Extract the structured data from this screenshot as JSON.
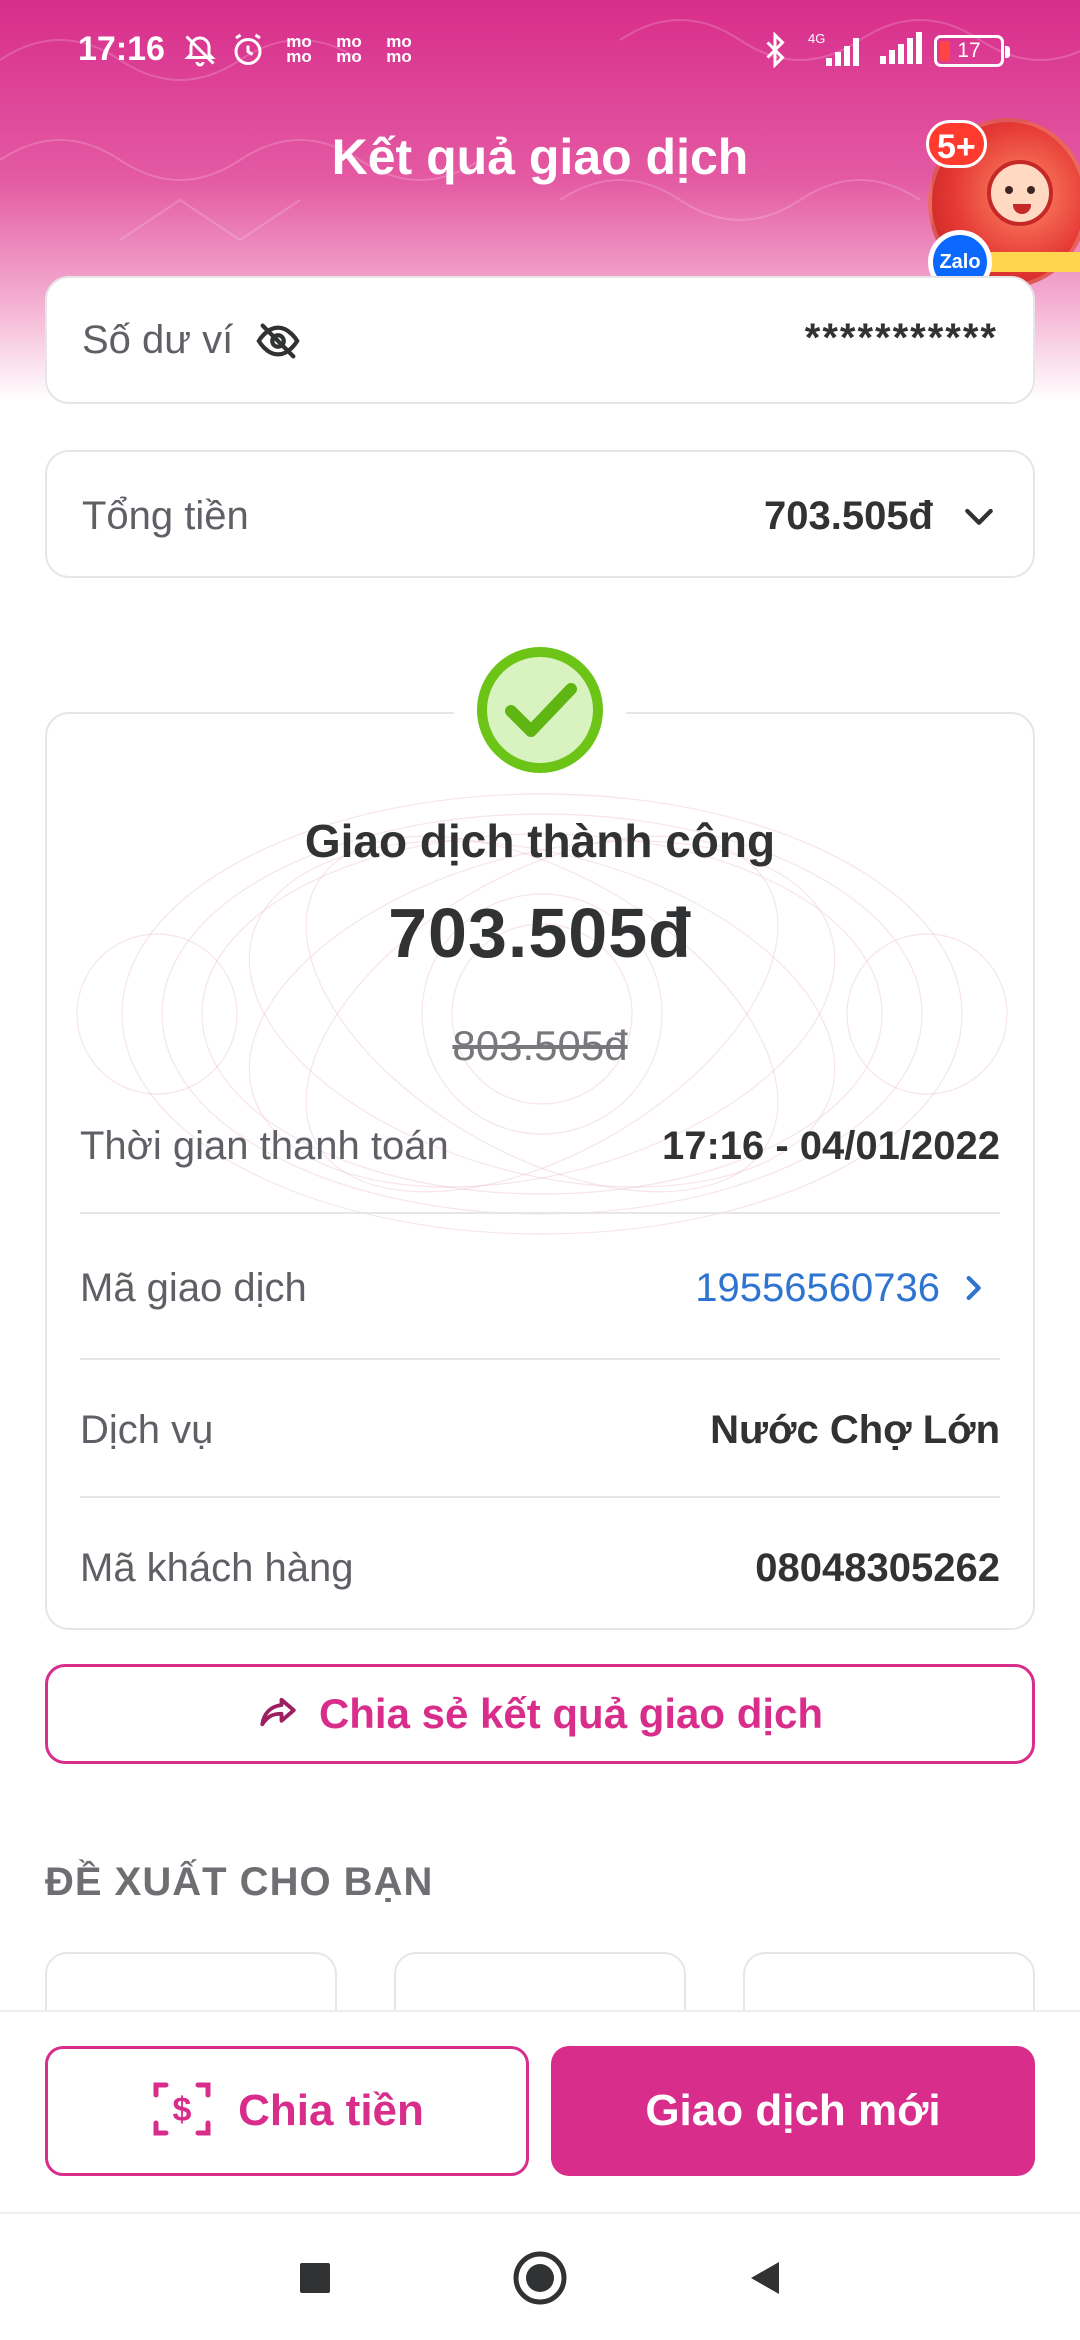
{
  "status_bar": {
    "time": "17:16",
    "network_label": "4G",
    "battery_level": "17",
    "icons": [
      "silent-bell-icon",
      "alarm-icon",
      "momo-notification-icon",
      "momo-notification-icon",
      "momo-notification-icon",
      "bluetooth-icon",
      "signal-icon",
      "signal-icon",
      "battery-icon"
    ],
    "momo_icon_text": "mo\nmo"
  },
  "header": {
    "title": "Kết quả giao dịch",
    "promo_badge": "5+",
    "zalo_label": "Zalo"
  },
  "balance": {
    "label": "Số dư ví",
    "value": "***********",
    "icon": "eye-off-icon"
  },
  "total": {
    "label": "Tổng tiền",
    "value": "703.505đ",
    "icon": "chevron-down-icon"
  },
  "result": {
    "status_icon": "check-circle-icon",
    "status_color": "#6cc417",
    "status_label": "Giao dịch thành công",
    "amount": "703.505đ",
    "original_amount": "803.505đ",
    "details": [
      {
        "label": "Thời gian thanh toán",
        "value": "17:16 - 04/01/2022"
      },
      {
        "label": "Mã giao dịch",
        "value": "19556560736"
      },
      {
        "label": "Dịch vụ",
        "value": "Nước Chợ Lớn"
      },
      {
        "label": "Mã khách hàng",
        "value": "08048305262"
      }
    ]
  },
  "share_button": {
    "label": "Chia sẻ kết quả giao dịch",
    "icon": "share-icon"
  },
  "suggestions": {
    "title": "ĐỀ XUẤT CHO BẠN"
  },
  "actions": {
    "split_label": "Chia tiền",
    "split_icon": "split-money-icon",
    "new_transaction_label": "Giao dịch mới"
  },
  "colors": {
    "brand": "#d82d8b",
    "link": "#2e74d0",
    "success": "#6cc417"
  }
}
